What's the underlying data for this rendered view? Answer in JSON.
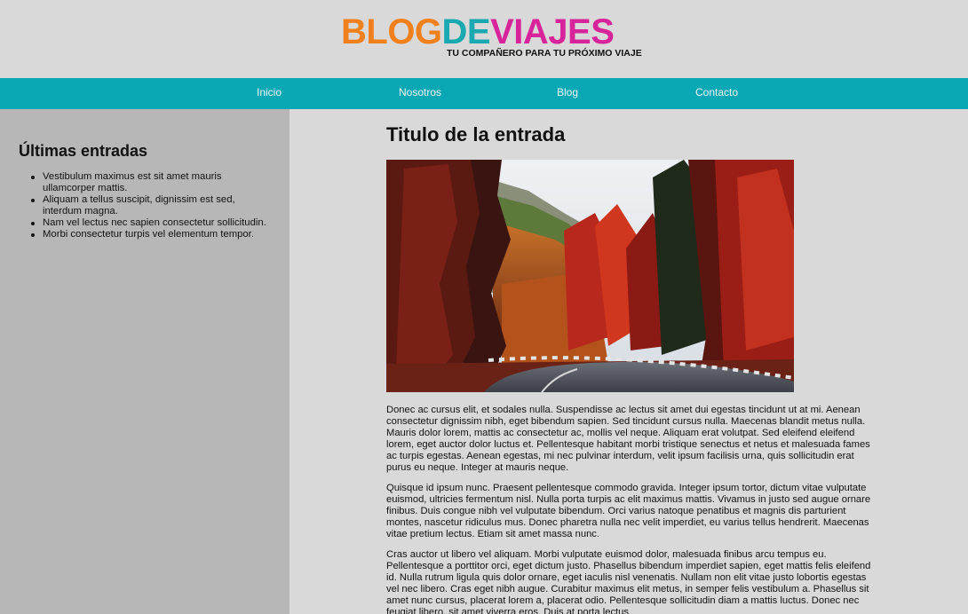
{
  "logo": {
    "part1": "BLOG",
    "part2": "DE",
    "part3": "VIAJES",
    "tagline": "TU COMPAÑERO PARA TU PRÓXIMO VIAJE",
    "colors": {
      "blog": "#f0801c",
      "de": "#1aa8b1",
      "viajes": "#d8249a"
    }
  },
  "nav": {
    "color": "#0aa7b5",
    "items": [
      {
        "label": "Inicio"
      },
      {
        "label": "Nosotros"
      },
      {
        "label": "Blog"
      },
      {
        "label": "Contacto"
      }
    ]
  },
  "sidebar": {
    "heading": "Últimas entradas",
    "items": [
      "Vestibulum maximus est sit amet mauris ullamcorper mattis.",
      "Aliquam a tellus suscipit, dignissim est sed, interdum magna.",
      "Nam vel lectus nec sapien consectetur sollicitudin.",
      "Morbi consectetur turpis vel elementum tempor."
    ]
  },
  "post": {
    "title": "Titulo de la entrada",
    "image": "autumn-forest-road-photo",
    "paragraphs": [
      "Donec ac cursus elit, et sodales nulla. Suspendisse ac lectus sit amet dui egestas tincidunt ut at mi. Aenean consectetur dignissim nibh, eget bibendum sapien. Sed tincidunt cursus nulla. Maecenas blandit metus nulla. Mauris dolor lorem, mattis ac consectetur ac, mollis vel neque. Aliquam erat volutpat. Sed eleifend eleifend lorem, eget auctor dolor luctus et. Pellentesque habitant morbi tristique senectus et netus et malesuada fames ac turpis egestas. Aenean egestas, mi nec pulvinar interdum, velit ipsum facilisis urna, quis sollicitudin erat purus eu neque. Integer at mauris neque.",
      "Quisque id ipsum nunc. Praesent pellentesque commodo gravida. Integer ipsum tortor, dictum vitae vulputate euismod, ultricies fermentum nisl. Nulla porta turpis ac elit maximus mattis. Vivamus in justo sed augue ornare finibus. Duis congue nibh vel vulputate bibendum. Orci varius natoque penatibus et magnis dis parturient montes, nascetur ridiculus mus. Donec pharetra nulla nec velit imperdiet, eu varius tellus hendrerit. Maecenas vitae pretium lectus. Etiam sit amet massa nunc.",
      "Cras auctor ut libero vel aliquam. Morbi vulputate euismod dolor, malesuada finibus arcu tempus eu. Pellentesque a porttitor orci, eget dictum justo. Phasellus bibendum imperdiet sapien, eget mattis felis eleifend id. Nulla rutrum ligula quis dolor ornare, eget iaculis nisl venenatis. Nullam non elit vitae justo lobortis egestas vel nec libero. Cras eget nibh augue. Curabitur maximus elit metus, in semper felis vestibulum a. Phasellus sit amet nunc cursus, placerat lorem a, placerat odio. Pellentesque sollicitudin diam a mattis luctus. Donec nec feugiat libero, sit amet viverra eros. Duis at porta lectus."
    ]
  }
}
